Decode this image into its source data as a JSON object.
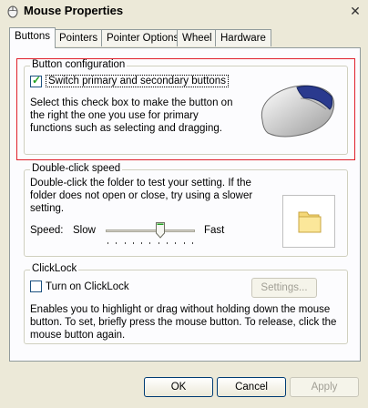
{
  "window": {
    "title": "Mouse Properties",
    "close_glyph": "✕"
  },
  "tabs": [
    {
      "label": "Buttons",
      "active": true
    },
    {
      "label": "Pointers"
    },
    {
      "label": "Pointer Options"
    },
    {
      "label": "Wheel"
    },
    {
      "label": "Hardware"
    }
  ],
  "button_config": {
    "title": "Button configuration",
    "checkbox_label": "Switch primary and secondary buttons",
    "checked": true,
    "description": "Select this check box to make the button on the right the one you use for primary functions such as selecting and dragging."
  },
  "double_click": {
    "title": "Double-click speed",
    "description": "Double-click the folder to test your setting. If the folder does not open or close, try using a slower setting.",
    "speed_label": "Speed:",
    "slow_label": "Slow",
    "fast_label": "Fast"
  },
  "clicklock": {
    "title": "ClickLock",
    "checkbox_label": "Turn on ClickLock",
    "checked": false,
    "settings_button": "Settings...",
    "description": "Enables you to highlight or drag without holding down the mouse button. To set, briefly press the mouse button. To release, click the mouse button again."
  },
  "footer": {
    "ok": "OK",
    "cancel": "Cancel",
    "apply": "Apply"
  },
  "colors": {
    "highlight_border": "#e0202b",
    "check_green": "#21a121"
  }
}
